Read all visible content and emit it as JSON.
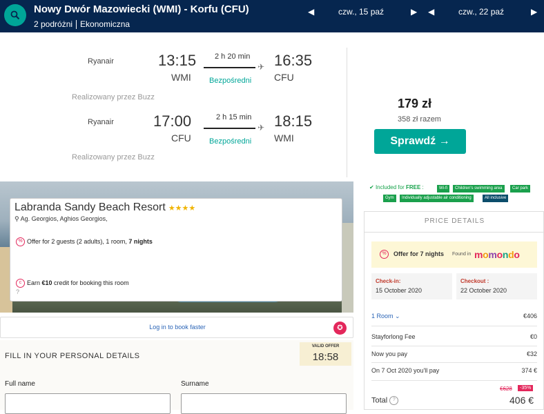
{
  "header": {
    "route": "Nowy Dwór Mazowiecki (WMI) - Korfu (CFU)",
    "travellers": "2 podróżni",
    "cabin": "Ekonomiczna",
    "depart_date": "czw., 15 paź",
    "return_date": "czw., 22 paź"
  },
  "outbound": {
    "airline": "Ryanair",
    "dep_time": "13:15",
    "dep_code": "WMI",
    "duration": "2 h 20 min",
    "stops": "Bezpośredni",
    "arr_time": "16:35",
    "arr_code": "CFU",
    "operated": "Realizowany przez Buzz"
  },
  "inbound": {
    "airline": "Ryanair",
    "dep_time": "17:00",
    "dep_code": "CFU",
    "duration": "2 h 15 min",
    "stops": "Bezpośredni",
    "arr_time": "18:15",
    "arr_code": "WMI",
    "operated": "Realizowany przez Buzz"
  },
  "fare": {
    "price": "179 zł",
    "total": "358 zł razem",
    "button": "Sprawdź"
  },
  "hotel": {
    "name": "Labranda Sandy Beach Resort",
    "stars": "★★★★",
    "address": "Ag. Georgios, Aghios Georgios,",
    "offer_prefix": "Offer for 2 guests (2 adults), 1 room, ",
    "offer_nights": "7 nights",
    "credit_prefix": "Earn ",
    "credit_amount": "€10",
    "credit_suffix": " credit for booking this room"
  },
  "login": {
    "link": "Log in to book faster"
  },
  "personal": {
    "title": "FILL IN YOUR PERSONAL DETAILS",
    "valid_label": "VALID OFFER",
    "timer": "18:58",
    "full_name_label": "Full name",
    "surname_label": "Surname"
  },
  "amenities": {
    "prefix": "Included for ",
    "free": "FREE",
    "tags": [
      "Wi-fi",
      "Children's swimming area",
      "Car park",
      "Gym",
      "Individually adjustable air conditioning",
      "All inclusive"
    ]
  },
  "price_details": {
    "title": "PRICE DETAILS",
    "offer_text": "Offer for 7 nights",
    "found_in": "Found in",
    "brand": "momondo",
    "checkin_label": "Check-in:",
    "checkin_date": "15 October 2020",
    "checkout_label": "Checkout :",
    "checkout_date": "22 October 2020",
    "room_label": "1 Room",
    "room_price": "€406",
    "fee_label": "Stayforlong Fee",
    "fee_value": "€0",
    "now_label": "Now you pay",
    "now_value": "€32",
    "later_label": "On 7 Oct 2020 you'll pay",
    "later_value": "374 €",
    "old_price": "€628",
    "discount": "-35%",
    "total_label": "Total",
    "total_value": "406 €"
  },
  "colors": {
    "navy": "#06264f",
    "teal": "#00a698",
    "pink": "#e3275b",
    "green": "#1aa04c"
  }
}
